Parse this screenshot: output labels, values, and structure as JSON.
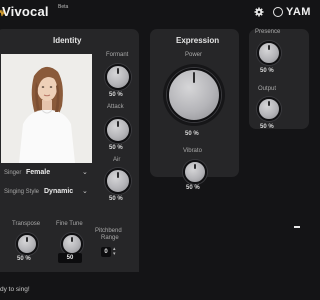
{
  "header": {
    "logo_text": "Vivocal",
    "logo_badge": "Beta",
    "brand_text": "YAM",
    "gear_icon": "gear-icon"
  },
  "identity": {
    "title": "Identity",
    "singer_label": "Singer",
    "singer_value": "Female",
    "singing_style_label": "Singing Style",
    "singing_style_value": "Dynamic",
    "formant_label": "Formant",
    "formant_value": "50 %",
    "attack_label": "Attack",
    "attack_value": "50 %",
    "air_label": "Air",
    "air_value": "50 %",
    "transpose_label": "Transpose",
    "transpose_value": "50 %",
    "fine_tune_label": "Fine Tune",
    "fine_tune_value": "50",
    "pitchbend_label_line1": "Pitchbend",
    "pitchbend_label_line2": "Range",
    "pitchbend_value": "0"
  },
  "expression": {
    "title": "Expression",
    "power_label": "Power",
    "power_value": "50 %",
    "vibrato_label": "Vibrato",
    "vibrato_value": "50 %"
  },
  "right": {
    "presence_label": "Presence",
    "presence_value": "50 %",
    "output_label": "Output",
    "output_value": "50 %"
  },
  "status": {
    "text": "dy to sing!"
  },
  "colors": {
    "accent_gold": "#e0a630",
    "panel_bg": "#262628",
    "app_bg": "#141416"
  }
}
